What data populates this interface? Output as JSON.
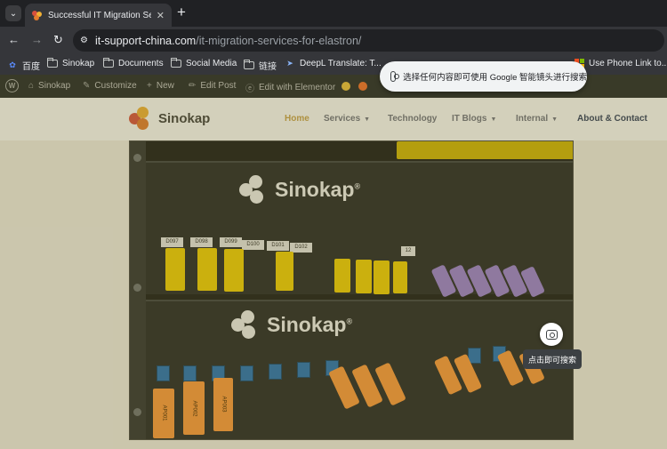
{
  "browser": {
    "tab": {
      "title": "Successful IT Migration Services"
    },
    "address": {
      "host": "it-support-china.com",
      "path": "/it-migration-services-for-elastron/"
    },
    "bookmarks": [
      {
        "label": "百度",
        "icon": "baidu-icon"
      },
      {
        "label": "Sinokap",
        "icon": "folder-icon"
      },
      {
        "label": "Documents",
        "icon": "folder-icon"
      },
      {
        "label": "Social Media",
        "icon": "folder-icon"
      },
      {
        "label": "链接",
        "icon": "folder-icon"
      },
      {
        "label": "DeepL Translate: T...",
        "icon": "deepl-icon"
      },
      {
        "label": "Use Phone Link to...",
        "icon": "microsoft-icon"
      }
    ]
  },
  "wp_admin_bar": {
    "site": "Sinokap",
    "customize": "Customize",
    "new": "New",
    "edit_post": "Edit Post",
    "elementor": "Edit with Elementor"
  },
  "site": {
    "logo": "Sinokap",
    "menu": {
      "home": "Home",
      "services": "Services",
      "technology": "Technology",
      "it_blogs": "IT Blogs",
      "internal": "Internal",
      "about": "About & Contact"
    }
  },
  "photo": {
    "brand": "Sinokap",
    "port_labels": [
      "D097",
      "D098",
      "D099",
      "D100",
      "D101",
      "D102"
    ],
    "panel_number": "12",
    "top_module_labels": [
      "D097",
      "D098",
      "D099",
      "D101"
    ],
    "bottom_module_labels": [
      "AP001",
      "AP002",
      "AP003"
    ]
  },
  "lens": {
    "toast": "选择任何内容即可使用 Google 智能镜头进行搜索",
    "tooltip": "点击即可搜索"
  },
  "colors": {
    "chrome_dark": "#202124",
    "chrome_toolbar": "#35363a",
    "wp_bar": "#1d2327",
    "accent_gold": "#c9a24a",
    "menu_dark": "#2c3a5c",
    "module_yellow": "#f4d000",
    "module_purple": "#9b7fd6",
    "module_orange": "#ff9a3c"
  }
}
